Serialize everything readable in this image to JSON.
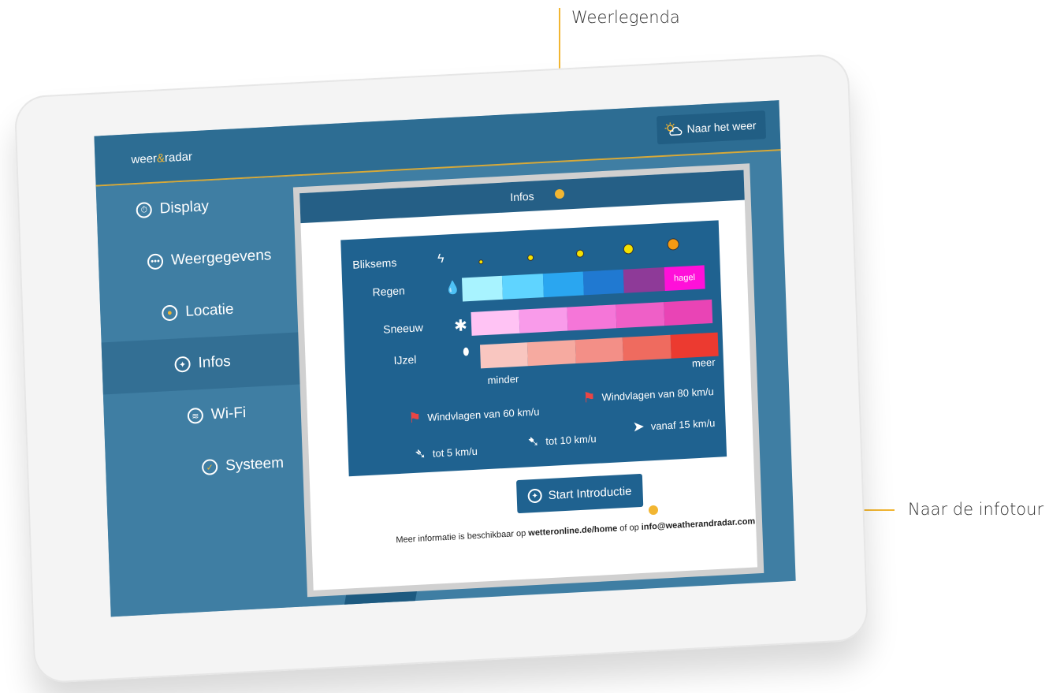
{
  "callouts": {
    "top": "Weerlegenda",
    "right": "Naar de infotour"
  },
  "header": {
    "logo_part1": "weer",
    "logo_amp": "&",
    "logo_part2": "radar",
    "weather_button": "Naar het weer"
  },
  "sidebar": {
    "items": [
      {
        "label": "Display",
        "icon": "clock-icon"
      },
      {
        "label": "Weergegevens",
        "icon": "dots-icon"
      },
      {
        "label": "Locatie",
        "icon": "location-icon"
      },
      {
        "label": "Infos",
        "icon": "lightbulb-icon"
      },
      {
        "label": "Wi-Fi",
        "icon": "wifi-icon"
      },
      {
        "label": "Systeem",
        "icon": "check-icon"
      }
    ],
    "active": "Infos"
  },
  "content": {
    "title": "Infos",
    "legend": {
      "rows": [
        {
          "label": "Bliksems",
          "icon": "lightning-icon"
        },
        {
          "label": "Regen",
          "icon": "raindrop-icon"
        },
        {
          "label": "Sneeuw",
          "icon": "snowflake-icon"
        },
        {
          "label": "IJzel",
          "icon": "ice-drop-icon"
        }
      ],
      "rain_colors": [
        "#a8f3ff",
        "#5fd4ff",
        "#2aa6f0",
        "#2079d1",
        "#8e3a98",
        "#ff10d9"
      ],
      "snow_colors": [
        "#ffc3f4",
        "#f99bea",
        "#f576d8",
        "#ef5fc7",
        "#e944b5"
      ],
      "ice_colors": [
        "#f9c6c0",
        "#f6aaa0",
        "#f38f87",
        "#ef6b5f",
        "#ec3a30"
      ],
      "lightning_colors": [
        "#f5e100",
        "#f5e100",
        "#f5e100",
        "#f5e100",
        "#f59a12"
      ],
      "hagel": "hagel",
      "minder": "minder",
      "meer": "meer",
      "gust60": "Windvlagen van 60 km/u",
      "gust80": "Windvlagen van 80 km/u",
      "wind5": "tot 5 km/u",
      "wind10": "tot 10 km/u",
      "wind15": "vanaf 15 km/u"
    },
    "start_button": "Start Introductie",
    "footer_prefix": "Meer informatie is beschikbaar op ",
    "footer_link1": "wetteronline.de/home",
    "footer_mid": " of op ",
    "footer_link2": "info@weatherandradar.com"
  }
}
